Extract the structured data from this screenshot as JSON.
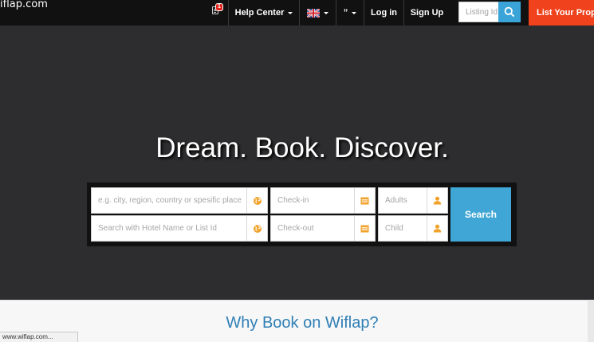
{
  "brand": {
    "logo_text": "iflap.com"
  },
  "navbar": {
    "notification_count": "1",
    "help_center_label": "Help Center",
    "currency_label": "”",
    "login_label": "Log in",
    "signup_label": "Sign Up",
    "search_placeholder": "Listing Id",
    "list_property_label": "List Your Property",
    "accent_color": "#f0421c",
    "search_button_color": "#3aa4d8"
  },
  "hero": {
    "title": "Dream. Book. Discover.",
    "destination_placeholder": "e.g. city, region, country or spesific place",
    "hotel_placeholder": "Search with Hotel Name or List Id",
    "checkin_placeholder": "Check-in",
    "checkout_placeholder": "Check-out",
    "adults_placeholder": "Adults",
    "child_placeholder": "Child",
    "search_label": "Search",
    "icon_color": "#f0a22a"
  },
  "section": {
    "why_title": "Why Book on Wiflap?"
  },
  "status_bar": {
    "url": "www.wiflap.com..."
  }
}
